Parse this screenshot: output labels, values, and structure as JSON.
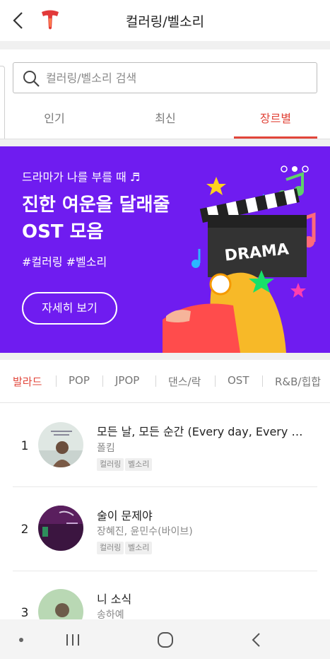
{
  "header": {
    "title": "컬러링/벨소리"
  },
  "search": {
    "placeholder": "컬러링/벨소리 검색",
    "value": ""
  },
  "tabs": [
    {
      "label": "인기",
      "active": false
    },
    {
      "label": "최신",
      "active": false
    },
    {
      "label": "장르별",
      "active": true
    }
  ],
  "banner": {
    "eyebrow": "드라마가 나를 부를 때 ♬",
    "headline_line1": "진한 여운을 달래줄",
    "headline_line2": "OST 모음",
    "tags": "#컬러링 #벨소리",
    "cta_label": "자세히 보기",
    "art_text": "DRAMA",
    "bg_color": "#6f1cf0"
  },
  "genres": [
    {
      "label": "발라드",
      "active": true
    },
    {
      "label": "POP",
      "active": false
    },
    {
      "label": "JPOP",
      "active": false
    },
    {
      "label": "댄스/락",
      "active": false
    },
    {
      "label": "OST",
      "active": false
    },
    {
      "label": "R&B/힙합",
      "active": false
    }
  ],
  "songs": [
    {
      "rank": "1",
      "title": "모든 날, 모든 순간 (Every day, Every Moment)",
      "artist": "폴킴",
      "tags": [
        "컬러링",
        "벨소리"
      ]
    },
    {
      "rank": "2",
      "title": "술이 문제야",
      "artist": "장혜진, 윤민수(바이브)",
      "tags": [
        "컬러링",
        "벨소리"
      ]
    },
    {
      "rank": "3",
      "title": "니 소식",
      "artist": "송하예",
      "tags": []
    }
  ],
  "colors": {
    "accent": "#e1453a",
    "banner": "#6f1cf0"
  },
  "icons": {
    "back": "chevron-left-icon",
    "logo": "t-logo-icon",
    "search": "search-icon",
    "nav_recent": "recent-apps-icon",
    "nav_home": "home-icon",
    "nav_back": "back-icon"
  }
}
